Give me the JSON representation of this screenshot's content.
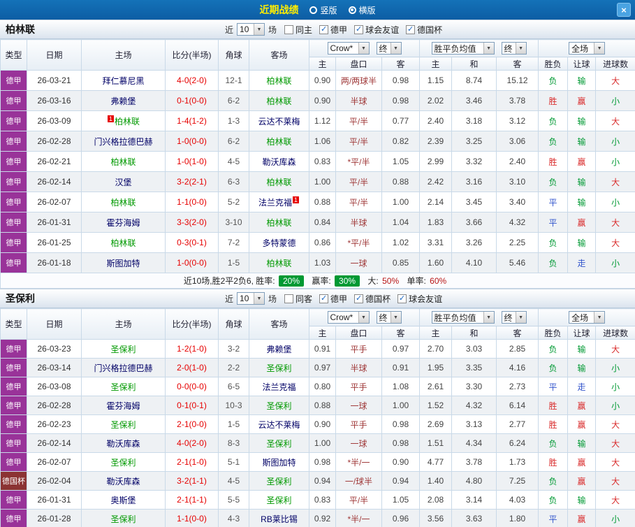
{
  "titlebar": {
    "title": "近期战绩",
    "vertical_label": "竖版",
    "horizontal_label": "横版",
    "selected_layout": "横版",
    "close": "×"
  },
  "table_columns": [
    "类型",
    "日期",
    "主场",
    "比分(半场)",
    "角球",
    "客场",
    "主",
    "盘口",
    "客",
    "主",
    "和",
    "客",
    "胜负",
    "让球",
    "进球数"
  ],
  "colors": {
    "win_red": "#d92b2b",
    "lose_green": "#009933",
    "draw_blue": "#3355cc",
    "score_red": "#e60000",
    "team_green": "#009900",
    "opponent_navy": "#000066",
    "league_purple": "#993399",
    "cup_maroon": "#8b3333",
    "handicap_maroon": "#a03a3a",
    "badge_green": "#009933",
    "titlebar_blue": "#1472b8",
    "title_yellow": "#ffee00"
  },
  "sections": [
    {
      "team": "柏林联",
      "filters": {
        "near": "近",
        "count": "10",
        "games": "场",
        "checkboxes": [
          {
            "label": "同主",
            "checked": false
          },
          {
            "label": "德甲",
            "checked": true
          },
          {
            "label": "球会友谊",
            "checked": true
          },
          {
            "label": "德国杯",
            "checked": true
          }
        ]
      },
      "selects": {
        "book": "Crow*",
        "final_a": "终",
        "avg": "胜平负均值",
        "final_b": "终",
        "scope": "全场"
      },
      "rows": [
        {
          "type": "德甲",
          "date": "26-03-21",
          "home": "拜仁慕尼黑",
          "home_is_team": false,
          "home_card": "",
          "score": "4-0",
          "half": "(2-0)",
          "corner": "12-1",
          "away": "柏林联",
          "away_is_team": true,
          "away_card": "",
          "ah_home": "0.90",
          "line": "两/两球半",
          "ah_away": "0.98",
          "o_home": "1.15",
          "o_draw": "8.74",
          "o_away": "15.12",
          "result": "负",
          "handicap_result": "输",
          "goals_result": "大"
        },
        {
          "type": "德甲",
          "date": "26-03-16",
          "home": "弗赖堡",
          "home_is_team": false,
          "home_card": "",
          "score": "0-1",
          "half": "(0-0)",
          "corner": "6-2",
          "away": "柏林联",
          "away_is_team": true,
          "away_card": "",
          "ah_home": "0.90",
          "line": "半球",
          "ah_away": "0.98",
          "o_home": "2.02",
          "o_draw": "3.46",
          "o_away": "3.78",
          "result": "胜",
          "handicap_result": "赢",
          "goals_result": "小"
        },
        {
          "type": "德甲",
          "date": "26-03-09",
          "home": "柏林联",
          "home_is_team": true,
          "home_card": "1",
          "score": "1-4",
          "half": "(1-2)",
          "corner": "1-3",
          "away": "云达不莱梅",
          "away_is_team": false,
          "away_card": "",
          "ah_home": "1.12",
          "line": "平/半",
          "ah_away": "0.77",
          "o_home": "2.40",
          "o_draw": "3.18",
          "o_away": "3.12",
          "result": "负",
          "handicap_result": "输",
          "goals_result": "大"
        },
        {
          "type": "德甲",
          "date": "26-02-28",
          "home": "门兴格拉德巴赫",
          "home_is_team": false,
          "home_card": "",
          "score": "1-0",
          "half": "(0-0)",
          "corner": "6-2",
          "away": "柏林联",
          "away_is_team": true,
          "away_card": "",
          "ah_home": "1.06",
          "line": "平/半",
          "ah_away": "0.82",
          "o_home": "2.39",
          "o_draw": "3.25",
          "o_away": "3.06",
          "result": "负",
          "handicap_result": "输",
          "goals_result": "小"
        },
        {
          "type": "德甲",
          "date": "26-02-21",
          "home": "柏林联",
          "home_is_team": true,
          "home_card": "",
          "score": "1-0",
          "half": "(1-0)",
          "corner": "4-5",
          "away": "勒沃库森",
          "away_is_team": false,
          "away_card": "",
          "ah_home": "0.83",
          "line": "*平/半",
          "ah_away": "1.05",
          "o_home": "2.99",
          "o_draw": "3.32",
          "o_away": "2.40",
          "result": "胜",
          "handicap_result": "赢",
          "goals_result": "小"
        },
        {
          "type": "德甲",
          "date": "26-02-14",
          "home": "汉堡",
          "home_is_team": false,
          "home_card": "",
          "score": "3-2",
          "half": "(2-1)",
          "corner": "6-3",
          "away": "柏林联",
          "away_is_team": true,
          "away_card": "",
          "ah_home": "1.00",
          "line": "平/半",
          "ah_away": "0.88",
          "o_home": "2.42",
          "o_draw": "3.16",
          "o_away": "3.10",
          "result": "负",
          "handicap_result": "输",
          "goals_result": "大"
        },
        {
          "type": "德甲",
          "date": "26-02-07",
          "home": "柏林联",
          "home_is_team": true,
          "home_card": "",
          "score": "1-1",
          "half": "(0-0)",
          "corner": "5-2",
          "away": "法兰克福",
          "away_is_team": false,
          "away_card": "1",
          "ah_home": "0.88",
          "line": "平/半",
          "ah_away": "1.00",
          "o_home": "2.14",
          "o_draw": "3.45",
          "o_away": "3.40",
          "result": "平",
          "handicap_result": "输",
          "goals_result": "小"
        },
        {
          "type": "德甲",
          "date": "26-01-31",
          "home": "霍芬海姆",
          "home_is_team": false,
          "home_card": "",
          "score": "3-3",
          "half": "(2-0)",
          "corner": "3-10",
          "away": "柏林联",
          "away_is_team": true,
          "away_card": "",
          "ah_home": "0.84",
          "line": "半球",
          "ah_away": "1.04",
          "o_home": "1.83",
          "o_draw": "3.66",
          "o_away": "4.32",
          "result": "平",
          "handicap_result": "赢",
          "goals_result": "大"
        },
        {
          "type": "德甲",
          "date": "26-01-25",
          "home": "柏林联",
          "home_is_team": true,
          "home_card": "",
          "score": "0-3",
          "half": "(0-1)",
          "corner": "7-2",
          "away": "多特蒙德",
          "away_is_team": false,
          "away_card": "",
          "ah_home": "0.86",
          "line": "*平/半",
          "ah_away": "1.02",
          "o_home": "3.31",
          "o_draw": "3.26",
          "o_away": "2.25",
          "result": "负",
          "handicap_result": "输",
          "goals_result": "大"
        },
        {
          "type": "德甲",
          "date": "26-01-18",
          "home": "斯图加特",
          "home_is_team": false,
          "home_card": "",
          "score": "1-0",
          "half": "(0-0)",
          "corner": "1-5",
          "away": "柏林联",
          "away_is_team": true,
          "away_card": "",
          "ah_home": "1.03",
          "line": "一球",
          "ah_away": "0.85",
          "o_home": "1.60",
          "o_draw": "4.10",
          "o_away": "5.46",
          "result": "负",
          "handicap_result": "走",
          "goals_result": "小"
        }
      ],
      "summary": {
        "record": "近10场,胜2平2负6,",
        "win_rate_label": "胜率:",
        "win_rate": "20%",
        "cover_rate_label": "赢率:",
        "cover_rate": "30%",
        "big_label": "大:",
        "big_rate": "50%",
        "odd_label": "单率:",
        "odd_rate": "60%"
      }
    },
    {
      "team": "圣保利",
      "filters": {
        "near": "近",
        "count": "10",
        "games": "场",
        "checkboxes": [
          {
            "label": "同客",
            "checked": false
          },
          {
            "label": "德甲",
            "checked": true
          },
          {
            "label": "德国杯",
            "checked": true
          },
          {
            "label": "球会友谊",
            "checked": true
          }
        ]
      },
      "selects": {
        "book": "Crow*",
        "final_a": "终",
        "avg": "胜平负均值",
        "final_b": "终",
        "scope": "全场"
      },
      "rows": [
        {
          "type": "德甲",
          "date": "26-03-23",
          "home": "圣保利",
          "home_is_team": true,
          "home_card": "",
          "score": "1-2",
          "half": "(1-0)",
          "corner": "3-2",
          "away": "弗赖堡",
          "away_is_team": false,
          "away_card": "",
          "ah_home": "0.91",
          "line": "平手",
          "ah_away": "0.97",
          "o_home": "2.70",
          "o_draw": "3.03",
          "o_away": "2.85",
          "result": "负",
          "handicap_result": "输",
          "goals_result": "大"
        },
        {
          "type": "德甲",
          "date": "26-03-14",
          "home": "门兴格拉德巴赫",
          "home_is_team": false,
          "home_card": "",
          "score": "2-0",
          "half": "(1-0)",
          "corner": "2-2",
          "away": "圣保利",
          "away_is_team": true,
          "away_card": "",
          "ah_home": "0.97",
          "line": "半球",
          "ah_away": "0.91",
          "o_home": "1.95",
          "o_draw": "3.35",
          "o_away": "4.16",
          "result": "负",
          "handicap_result": "输",
          "goals_result": "小"
        },
        {
          "type": "德甲",
          "date": "26-03-08",
          "home": "圣保利",
          "home_is_team": true,
          "home_card": "",
          "score": "0-0",
          "half": "(0-0)",
          "corner": "6-5",
          "away": "法兰克福",
          "away_is_team": false,
          "away_card": "",
          "ah_home": "0.80",
          "line": "平手",
          "ah_away": "1.08",
          "o_home": "2.61",
          "o_draw": "3.30",
          "o_away": "2.73",
          "result": "平",
          "handicap_result": "走",
          "goals_result": "小"
        },
        {
          "type": "德甲",
          "date": "26-02-28",
          "home": "霍芬海姆",
          "home_is_team": false,
          "home_card": "",
          "score": "0-1",
          "half": "(0-1)",
          "corner": "10-3",
          "away": "圣保利",
          "away_is_team": true,
          "away_card": "",
          "ah_home": "0.88",
          "line": "一球",
          "ah_away": "1.00",
          "o_home": "1.52",
          "o_draw": "4.32",
          "o_away": "6.14",
          "result": "胜",
          "handicap_result": "赢",
          "goals_result": "小"
        },
        {
          "type": "德甲",
          "date": "26-02-23",
          "home": "圣保利",
          "home_is_team": true,
          "home_card": "",
          "score": "2-1",
          "half": "(0-0)",
          "corner": "1-5",
          "away": "云达不莱梅",
          "away_is_team": false,
          "away_card": "",
          "ah_home": "0.90",
          "line": "平手",
          "ah_away": "0.98",
          "o_home": "2.69",
          "o_draw": "3.13",
          "o_away": "2.77",
          "result": "胜",
          "handicap_result": "赢",
          "goals_result": "大"
        },
        {
          "type": "德甲",
          "date": "26-02-14",
          "home": "勒沃库森",
          "home_is_team": false,
          "home_card": "",
          "score": "4-0",
          "half": "(2-0)",
          "corner": "8-3",
          "away": "圣保利",
          "away_is_team": true,
          "away_card": "",
          "ah_home": "1.00",
          "line": "一球",
          "ah_away": "0.98",
          "o_home": "1.51",
          "o_draw": "4.34",
          "o_away": "6.24",
          "result": "负",
          "handicap_result": "输",
          "goals_result": "大"
        },
        {
          "type": "德甲",
          "date": "26-02-07",
          "home": "圣保利",
          "home_is_team": true,
          "home_card": "",
          "score": "2-1",
          "half": "(1-0)",
          "corner": "5-1",
          "away": "斯图加特",
          "away_is_team": false,
          "away_card": "",
          "ah_home": "0.98",
          "line": "*半/一",
          "ah_away": "0.90",
          "o_home": "4.77",
          "o_draw": "3.78",
          "o_away": "1.73",
          "result": "胜",
          "handicap_result": "赢",
          "goals_result": "大"
        },
        {
          "type": "德国杯",
          "date": "26-02-04",
          "home": "勒沃库森",
          "home_is_team": false,
          "home_card": "",
          "score": "3-2",
          "half": "(1-1)",
          "corner": "4-5",
          "away": "圣保利",
          "away_is_team": true,
          "away_card": "",
          "ah_home": "0.94",
          "line": "一/球半",
          "ah_away": "0.94",
          "o_home": "1.40",
          "o_draw": "4.80",
          "o_away": "7.25",
          "result": "负",
          "handicap_result": "赢",
          "goals_result": "大"
        },
        {
          "type": "德甲",
          "date": "26-01-31",
          "home": "奥斯堡",
          "home_is_team": false,
          "home_card": "",
          "score": "2-1",
          "half": "(1-1)",
          "corner": "5-5",
          "away": "圣保利",
          "away_is_team": true,
          "away_card": "",
          "ah_home": "0.83",
          "line": "平/半",
          "ah_away": "1.05",
          "o_home": "2.08",
          "o_draw": "3.14",
          "o_away": "4.03",
          "result": "负",
          "handicap_result": "输",
          "goals_result": "大"
        },
        {
          "type": "德甲",
          "date": "26-01-28",
          "home": "圣保利",
          "home_is_team": true,
          "home_card": "",
          "score": "1-1",
          "half": "(0-0)",
          "corner": "4-3",
          "away": "RB莱比锡",
          "away_is_team": false,
          "away_card": "",
          "ah_home": "0.92",
          "line": "*半/一",
          "ah_away": "0.96",
          "o_home": "3.56",
          "o_draw": "3.63",
          "o_away": "1.80",
          "result": "平",
          "handicap_result": "赢",
          "goals_result": "小"
        }
      ]
    }
  ]
}
